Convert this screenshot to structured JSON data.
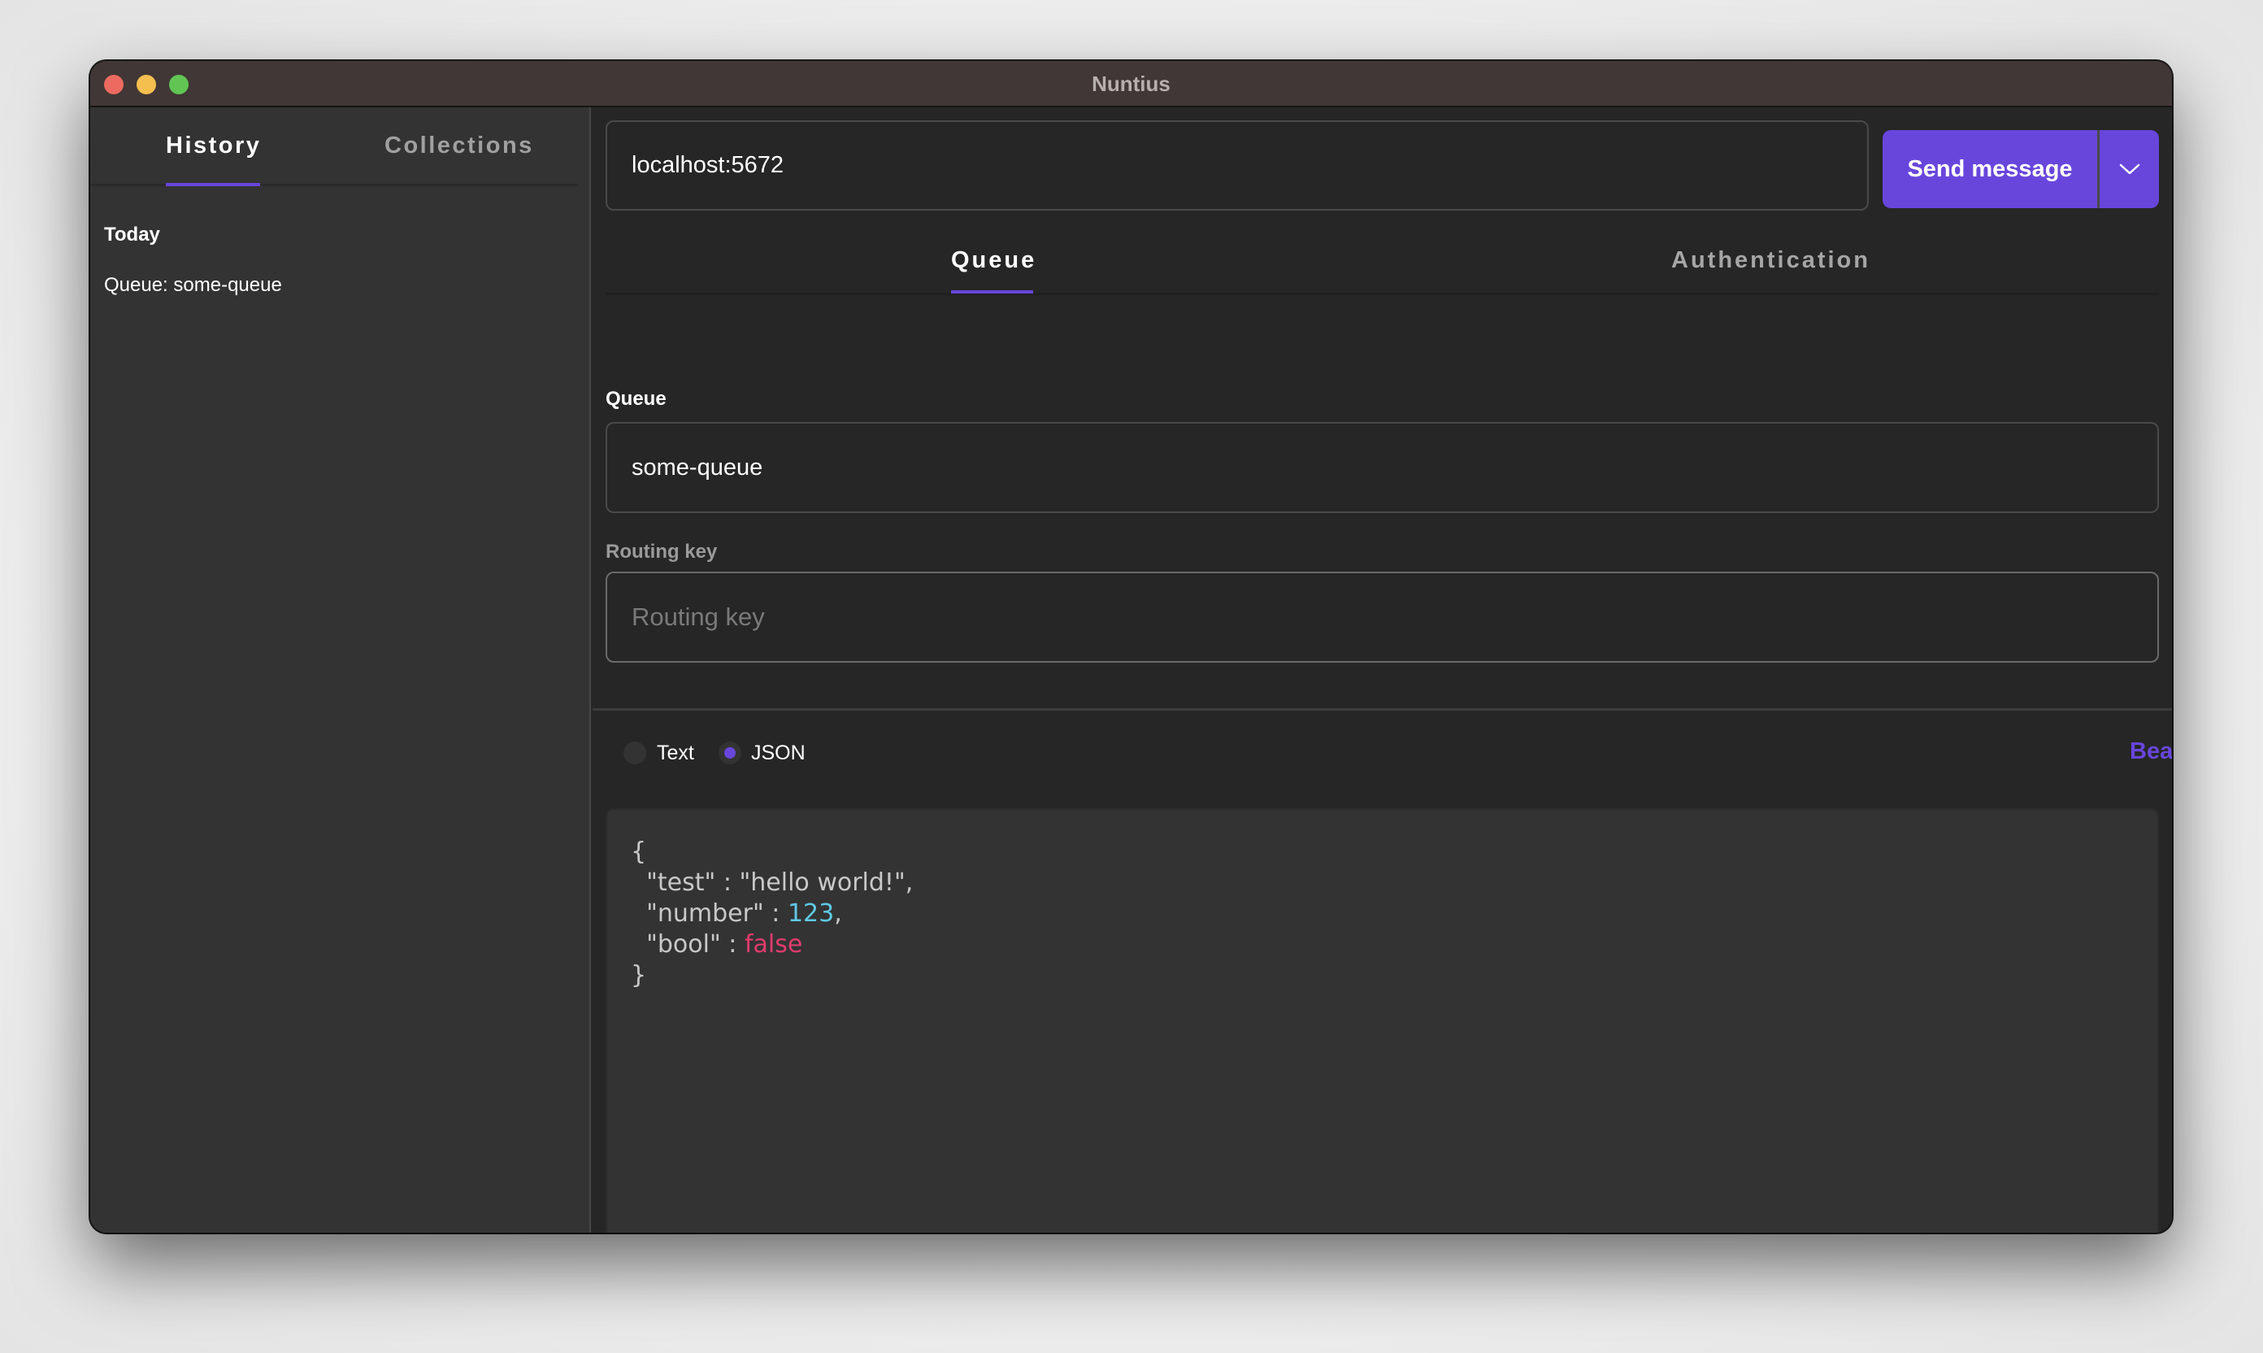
{
  "window": {
    "title": "Nuntius"
  },
  "sidebar": {
    "tabs": [
      {
        "label": "History",
        "active": true
      },
      {
        "label": "Collections",
        "active": false
      }
    ],
    "history": {
      "group_label": "Today",
      "items": [
        {
          "label": "Queue: some-queue"
        }
      ]
    }
  },
  "request": {
    "url_value": "localhost:5672",
    "send_label": "Send message",
    "send_dropdown_icon": "chevron-down-icon"
  },
  "tabs": [
    {
      "label": "Queue",
      "active": true
    },
    {
      "label": "Authentication",
      "active": false
    }
  ],
  "form": {
    "queue_label": "Queue",
    "queue_value": "some-queue",
    "routing_key_label": "Routing key",
    "routing_key_value": "",
    "routing_key_placeholder": "Routing key"
  },
  "body": {
    "formats": [
      {
        "label": "Text",
        "selected": false
      },
      {
        "label": "JSON",
        "selected": true
      }
    ],
    "beautify_label": "Beautify",
    "code_lines": [
      {
        "indent": "",
        "key": "",
        "sep": "",
        "value": "{",
        "value_type": "punct",
        "trail": ""
      },
      {
        "indent": "  ",
        "key": "\"test\"",
        "sep": " : ",
        "value": "\"hello world!\"",
        "value_type": "string",
        "trail": ","
      },
      {
        "indent": "  ",
        "key": "\"number\"",
        "sep": " : ",
        "value": "123",
        "value_type": "number",
        "trail": ","
      },
      {
        "indent": "  ",
        "key": "\"bool\"",
        "sep": " : ",
        "value": "false",
        "value_type": "bool",
        "trail": ""
      },
      {
        "indent": "",
        "key": "",
        "sep": "",
        "value": "}",
        "value_type": "punct",
        "trail": ""
      }
    ]
  },
  "colors": {
    "accent": "#6846dc",
    "titlebar": "#413736",
    "sidebar_bg": "#333333",
    "main_bg": "#262626",
    "json_number": "#5fc9e6",
    "json_bool": "#e23b6c"
  }
}
